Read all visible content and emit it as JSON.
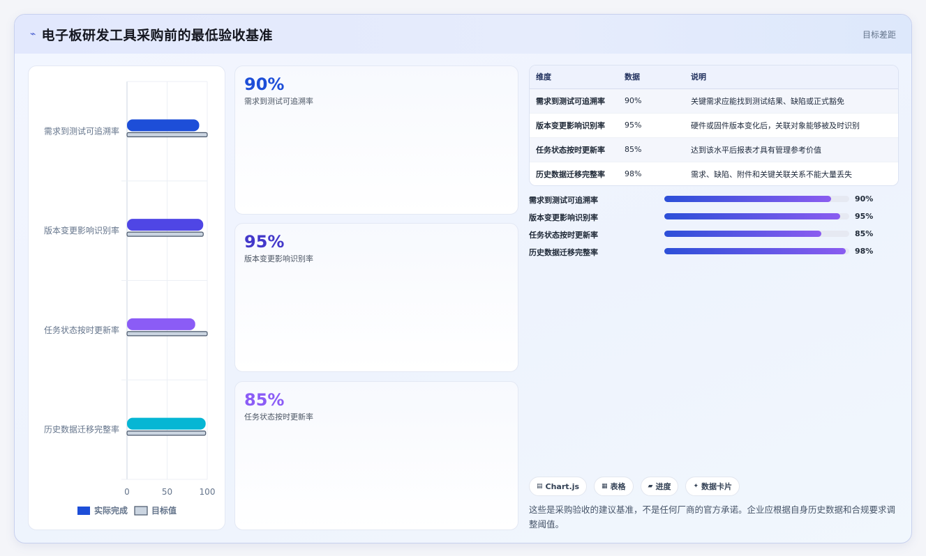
{
  "header": {
    "icon": "trend-arrow-icon",
    "title": "电子板研发工具采购前的最低验收基准",
    "right_label": "目标差距"
  },
  "chart_data": {
    "type": "bar",
    "orientation": "horizontal",
    "categories": [
      "需求到测试可追溯率",
      "版本变更影响识别率",
      "任务状态按时更新率",
      "历史数据迁移完整率"
    ],
    "series": [
      {
        "name": "实际完成",
        "values": [
          90,
          95,
          85,
          98
        ],
        "colors": [
          "#1d4ed8",
          "#4f46e5",
          "#8b5cf6",
          "#06b6d4"
        ]
      },
      {
        "name": "目标值",
        "values": [
          100,
          95,
          100,
          98
        ],
        "color": "#cbd5e1"
      }
    ],
    "xticks": [
      "0",
      "50",
      "100"
    ],
    "xlim": [
      0,
      100
    ],
    "grid": true,
    "legend": "bottom"
  },
  "stats": [
    {
      "value": "90%",
      "label": "需求到测试可追溯率",
      "color": "#1d4ed8"
    },
    {
      "value": "95%",
      "label": "版本变更影响识别率",
      "color": "#4338ca"
    },
    {
      "value": "85%",
      "label": "任务状态按时更新率",
      "color": "#8b5cf6"
    }
  ],
  "table": {
    "headers": [
      "维度",
      "数据",
      "说明"
    ],
    "rows": [
      [
        "需求到测试可追溯率",
        "90%",
        "关键需求应能找到测试结果、缺陷或正式豁免"
      ],
      [
        "版本变更影响识别率",
        "95%",
        "硬件或固件版本变化后，关联对象能够被及时识别"
      ],
      [
        "任务状态按时更新率",
        "85%",
        "达到该水平后报表才具有管理参考价值"
      ],
      [
        "历史数据迁移完整率",
        "98%",
        "需求、缺陷、附件和关键关联关系不能大量丢失"
      ]
    ]
  },
  "progress": [
    {
      "label": "需求到测试可追溯率",
      "value_text": "90%",
      "value": 0.9
    },
    {
      "label": "版本变更影响识别率",
      "value_text": "95%",
      "value": 0.95
    },
    {
      "label": "任务状态按时更新率",
      "value_text": "85%",
      "value": 0.85
    },
    {
      "label": "历史数据迁移完整率",
      "value_text": "98%",
      "value": 0.98
    }
  ],
  "chips": [
    {
      "icon": "chart-icon",
      "label": "Chart.js"
    },
    {
      "icon": "table-icon",
      "label": "表格"
    },
    {
      "icon": "progress-icon",
      "label": "进度"
    },
    {
      "icon": "sparkle-icon",
      "label": "数据卡片"
    }
  ],
  "note": "这些是采购验收的建议基准，不是任何厂商的官方承诺。企业应根据自身历史数据和合规要求调整阈值。"
}
